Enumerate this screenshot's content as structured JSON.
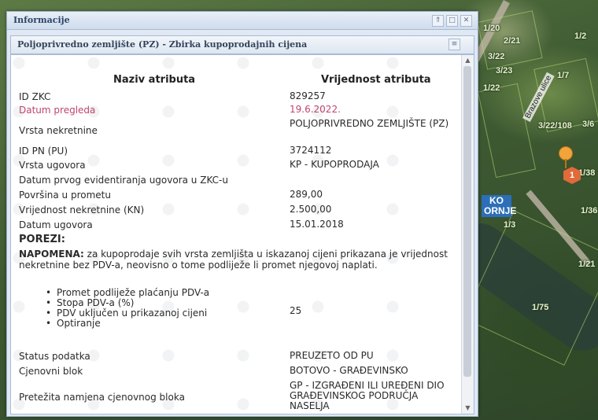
{
  "map": {
    "parcel_labels": [
      "1/20",
      "2/21",
      "3/22",
      "3/23",
      "1/22",
      "1/2",
      "1/7",
      "3/22/108",
      "3/6",
      "1/38",
      "1/36",
      "1/21",
      "1/75",
      "1/3"
    ],
    "street_name": "Brazove ulice",
    "ko_label": "KO ORNJE",
    "marker_number": "1"
  },
  "window": {
    "title": "Informacije",
    "tool_icons": [
      "collapse-icon",
      "maximize-icon",
      "close-icon"
    ]
  },
  "panel": {
    "title": "Poljoprivredno zemljište (PZ) - Zbirka kupoprodajnih cijena",
    "collapse_symbol": "≡"
  },
  "table": {
    "header_name": "Naziv atributa",
    "header_value": "Vrijednost atributa",
    "rows": [
      {
        "name": "ID ZKC",
        "value": "829257"
      },
      {
        "name": "Datum pregleda",
        "value": "19.6.2022."
      },
      {
        "name": "Vrsta nekretnine",
        "value": "POLJOPRIVREDNO ZEMLJIŠTE (PZ)"
      },
      {
        "name": "ID PN (PU)",
        "value": "3724112"
      },
      {
        "name": "Vrsta ugovora",
        "value": "KP - KUPOPRODAJA"
      },
      {
        "name": "Datum prvog evidentiranja ugovora u ZKC-u",
        "value": ""
      },
      {
        "name": "Površina u prometu",
        "value": "289,00"
      },
      {
        "name": "Vrijednost nekretnine (KN)",
        "value": "2.500,00"
      },
      {
        "name": "Datum ugovora",
        "value": "15.01.2018"
      }
    ],
    "taxes_heading": "POREZI:",
    "note_label": "NAPOMENA:",
    "note_text": " za kupoprodaje svih vrsta zemljišta u iskazanoj cijeni prikazana je vrijednost nekretnine bez PDV-a, neovisno o tome podliježe li promet njegovoj naplati.",
    "tax_items": [
      {
        "name": "Promet podliježe plaćanju PDV-a",
        "value": ""
      },
      {
        "name": "Stopa PDV-a (%)",
        "value": "25"
      },
      {
        "name": "PDV uključen u prikazanoj cijeni",
        "value": ""
      },
      {
        "name": "Optiranje",
        "value": ""
      }
    ],
    "rows_after": [
      {
        "name": "Status podatka",
        "value": "PREUZETO OD PU"
      },
      {
        "name": "Cjenovni blok",
        "value": "BOTOVO - GRAĐEVINSKO"
      },
      {
        "name": "Pretežita namjena cjenovnog bloka",
        "value": "GP - IZGRAĐENI ILI UREĐENI DIO GRAĐEVINSKOG PODRUČJA NASELJA"
      }
    ]
  }
}
